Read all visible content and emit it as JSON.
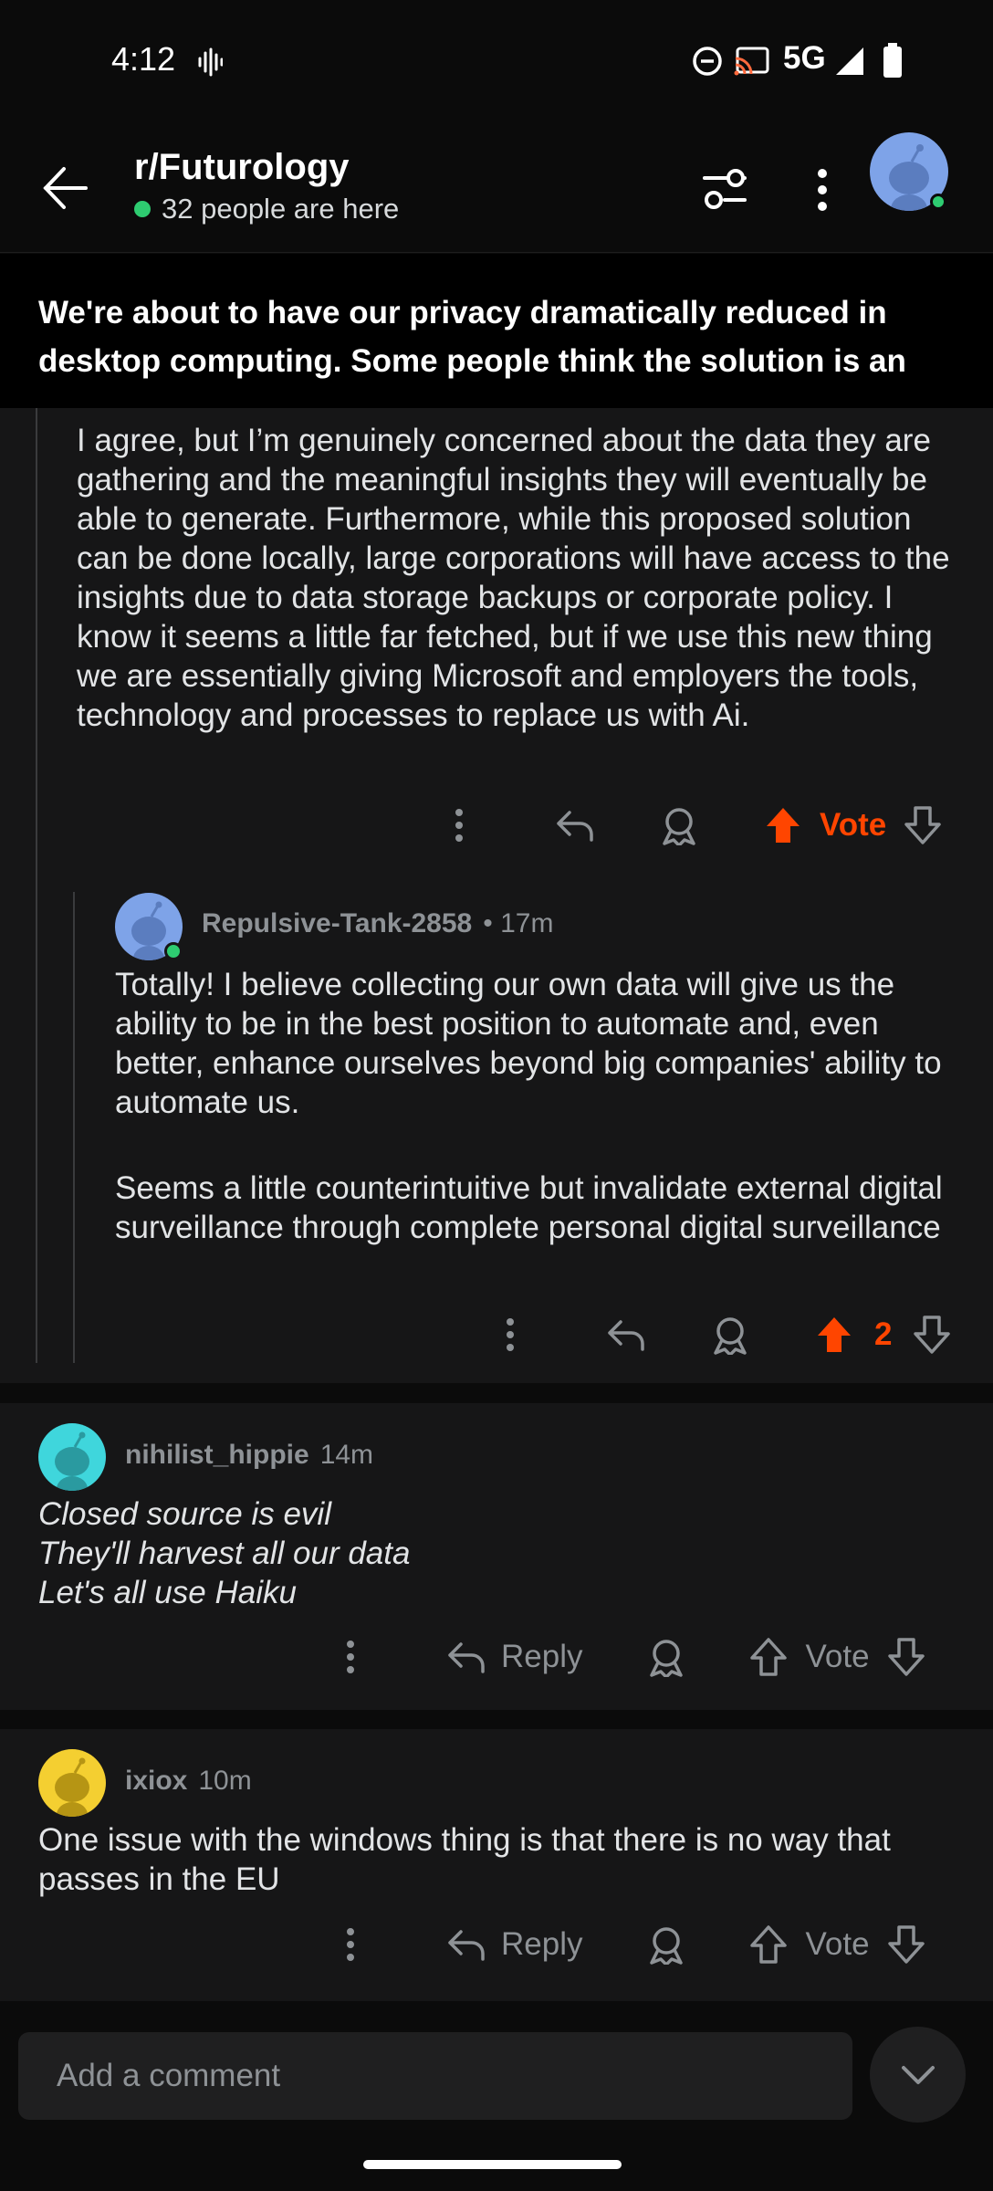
{
  "status_bar": {
    "time": "4:12",
    "network": "5G"
  },
  "header": {
    "subreddit": "r/Futurology",
    "online_text": "32 people are here"
  },
  "post": {
    "title": "We're about to have our privacy dramatically reduced in desktop computing. Some people think the solution is an op…"
  },
  "comments": [
    {
      "body": "I agree, but I’m genuinely concerned about the data they are gathering and the meaningful insights they will eventually be able to generate. Furthermore, while this proposed solution can be done locally, large corporations will have access to the insights due to data storage backups or corporate policy. I know it seems a little far fetched, but if we use this new thing we are essentially giving Microsoft and employers the tools, technology and processes to replace us with Ai.",
      "vote_label": "Vote",
      "upvoted": true
    },
    {
      "username": "Repulsive-Tank-2858",
      "time": "• 17m",
      "body_p1": "Totally! I believe collecting our own data will give us the ability to be in the best position to automate and, even better, enhance ourselves beyond big companies' ability to automate us.",
      "body_p2": "Seems a little counterintuitive but invalidate external digital surveillance through complete personal digital surveillance",
      "vote_label": "2",
      "upvoted": true
    },
    {
      "username": "nihilist_hippie",
      "time": "14m",
      "lines": [
        "Closed source is evil",
        "They'll harvest all our data",
        "Let's all use Haiku"
      ],
      "reply_label": "Reply",
      "vote_label": "Vote"
    },
    {
      "username": "ixiox",
      "time": "10m",
      "body": "One issue with the windows thing is that there is no way that passes in the EU",
      "reply_label": "Reply",
      "vote_label": "Vote"
    }
  ],
  "composer": {
    "placeholder": "Add a comment"
  },
  "colors": {
    "accent": "#ff4500",
    "online": "#2ecc71",
    "background": "#0b0b0b",
    "panel": "#161617"
  }
}
